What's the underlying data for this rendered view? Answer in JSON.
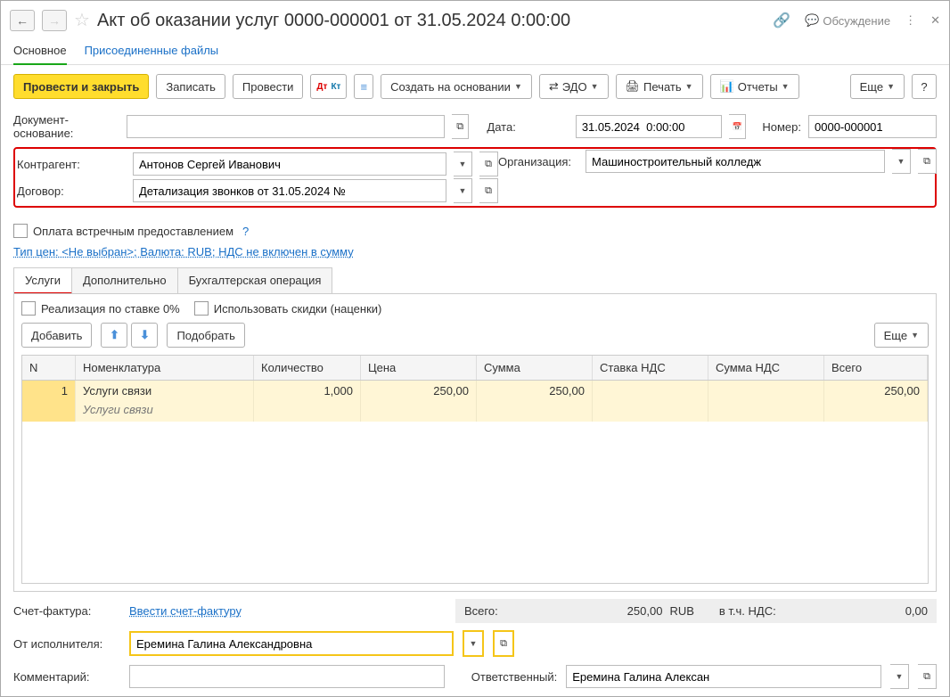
{
  "title": "Акт об оказании услуг 0000-000001 от 31.05.2024 0:00:00",
  "titlebar": {
    "discussion": "Обсуждение"
  },
  "pageTabs": {
    "main": "Основное",
    "files": "Присоединенные файлы"
  },
  "toolbar": {
    "postClose": "Провести и закрыть",
    "save": "Записать",
    "post": "Провести",
    "createBased": "Создать на основании",
    "edo": "ЭДО",
    "print": "Печать",
    "reports": "Отчеты",
    "more": "Еще"
  },
  "fields": {
    "docBaseLbl": "Документ-основание:",
    "docBase": "",
    "dateLbl": "Дата:",
    "date": "31.05.2024  0:00:00",
    "numberLbl": "Номер:",
    "number": "0000-000001",
    "counterpartyLbl": "Контрагент:",
    "counterparty": "Антонов Сергей Иванович",
    "orgLbl": "Организация:",
    "org": "Машиностроительный колледж",
    "contractLbl": "Договор:",
    "contract": "Детализация звонков от 31.05.2024 №",
    "counterPaymentLbl": "Оплата встречным предоставлением",
    "priceTypeLink": "Тип цен: <Не выбран>; Валюта: RUB; НДС не включен в сумму"
  },
  "subTabs": {
    "services": "Услуги",
    "additional": "Дополнительно",
    "accounting": "Бухгалтерская операция"
  },
  "servicesTab": {
    "zeroRateLbl": "Реализация по ставке 0%",
    "useDiscountsLbl": "Использовать скидки (наценки)",
    "add": "Добавить",
    "pick": "Подобрать",
    "more": "Еще",
    "cols": {
      "n": "N",
      "nom": "Номенклатура",
      "qty": "Количество",
      "price": "Цена",
      "sum": "Сумма",
      "vatRate": "Ставка НДС",
      "vatSum": "Сумма НДС",
      "total": "Всего"
    },
    "rows": [
      {
        "n": "1",
        "nom": "Услуги связи",
        "nomSub": "Услуги связи",
        "qty": "1,000",
        "price": "250,00",
        "sum": "250,00",
        "vatRate": "",
        "vatSum": "",
        "total": "250,00"
      }
    ]
  },
  "footer": {
    "invoiceLbl": "Счет-фактура:",
    "invoiceLink": "Ввести счет-фактуру",
    "totalLbl": "Всего:",
    "totalVal": "250,00",
    "currency": "RUB",
    "vatLbl": "в т.ч. НДС:",
    "vatVal": "0,00",
    "fromExecutorLbl": "От исполнителя:",
    "fromExecutor": "Еремина Галина Александровна",
    "commentLbl": "Комментарий:",
    "comment": "",
    "responsibleLbl": "Ответственный:",
    "responsible": "Еремина Галина Алексан"
  }
}
